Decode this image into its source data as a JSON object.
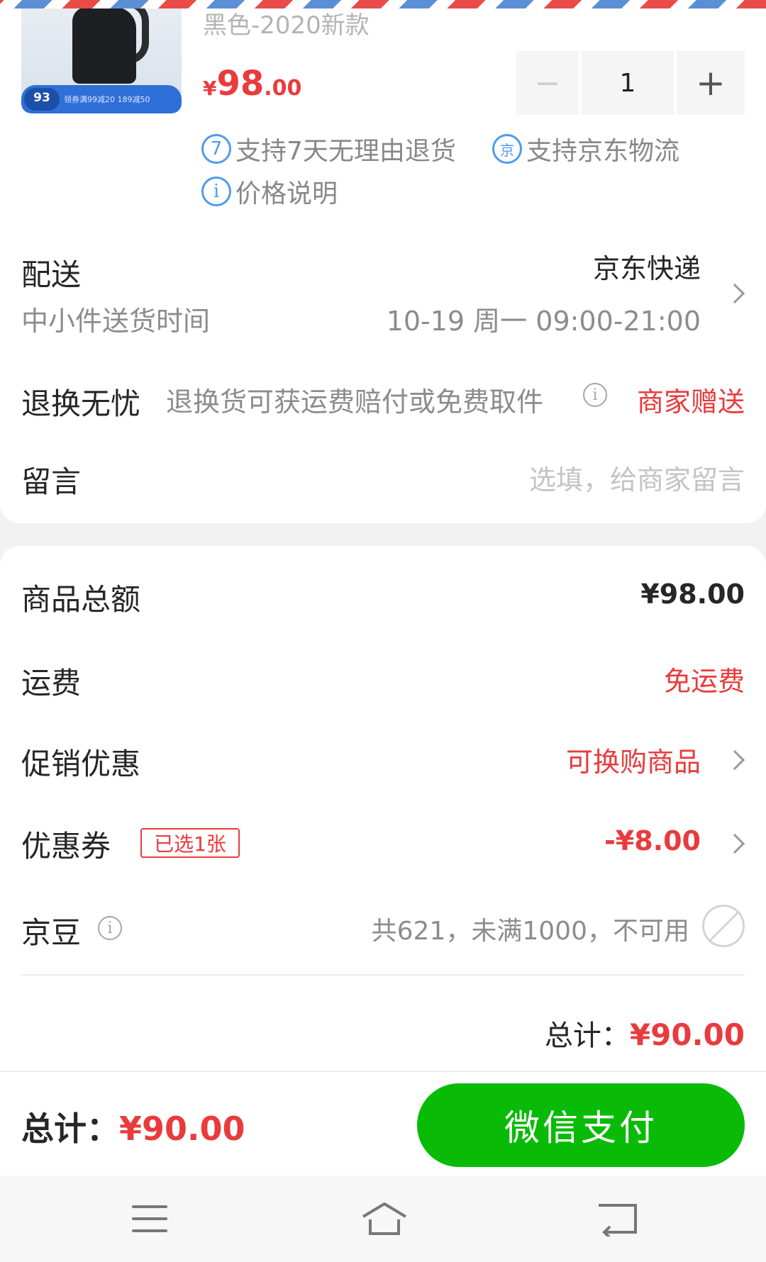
{
  "product": {
    "spec": "黑色-2020新款",
    "price_currency": "¥",
    "price_int": "98",
    "price_dec": ".00",
    "thumb_badge": "93",
    "thumb_promo": "领券满99减20 189减50",
    "quantity": "1",
    "minus": "−",
    "plus": "+"
  },
  "services": [
    {
      "icon": "7",
      "text": "支持7天无理由退货"
    },
    {
      "icon": "京",
      "text": "支持京东物流"
    },
    {
      "icon": "i",
      "text": "价格说明"
    }
  ],
  "delivery": {
    "label": "配送",
    "method": "京东快递",
    "sub_label": "中小件送货时间",
    "time": "10-19 周一 09:00-21:00"
  },
  "returns": {
    "label": "退换无忧",
    "desc": "退换货可获运费赔付或免费取件",
    "gift": "商家赠送"
  },
  "message": {
    "label": "留言",
    "placeholder": "选填，给商家留言"
  },
  "summary": {
    "goods_total_label": "商品总额",
    "goods_total": "¥98.00",
    "shipping_label": "运费",
    "shipping": "免运费",
    "promo_label": "促销优惠",
    "promo": "可换购商品",
    "coupon_label": "优惠券",
    "coupon_tag": "已选1张",
    "coupon_value": "-¥8.00",
    "jingdou_label": "京豆",
    "jingdou_status": "共621，未满1000，不可用",
    "total_label": "总计：",
    "total_value": "¥90.00"
  },
  "footer": {
    "total_label": "总计：",
    "total_value": "¥90.00",
    "pay_button": "微信支付"
  },
  "colors": {
    "accent_red": "#e93b3d",
    "pay_green": "#09bb07",
    "service_blue": "#4f9bea"
  }
}
